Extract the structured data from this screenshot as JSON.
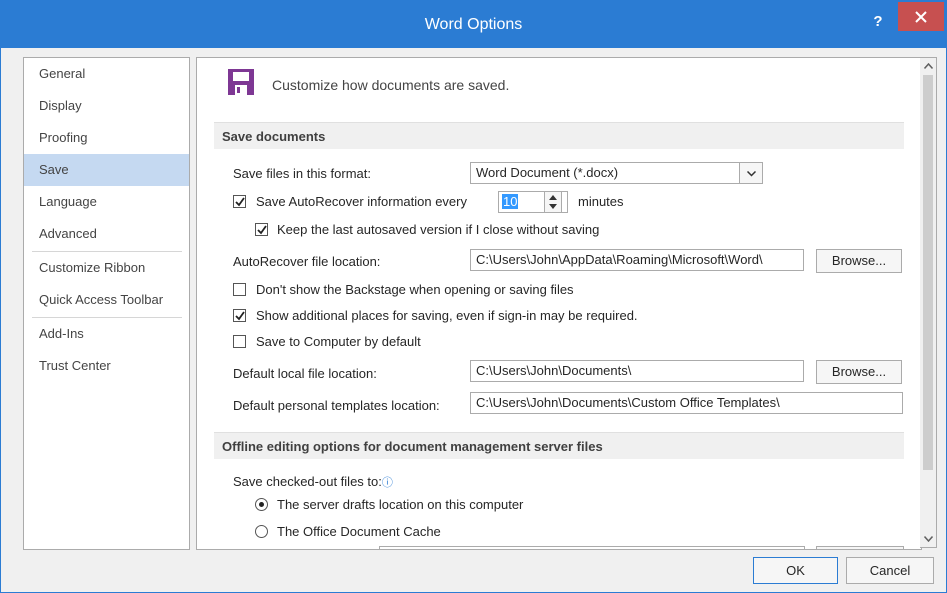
{
  "window": {
    "title": "Word Options",
    "help_glyph": "?",
    "accent": "#2b7cd3",
    "close_color": "#c75050"
  },
  "sidebar": {
    "items": [
      {
        "label": "General"
      },
      {
        "label": "Display"
      },
      {
        "label": "Proofing"
      },
      {
        "label": "Save",
        "selected": true
      },
      {
        "label": "Language"
      },
      {
        "label": "Advanced"
      },
      {
        "label": "Customize Ribbon"
      },
      {
        "label": "Quick Access Toolbar"
      },
      {
        "label": "Add-Ins"
      },
      {
        "label": "Trust Center"
      }
    ]
  },
  "header": {
    "text": "Customize how documents are saved.",
    "icon": "floppy-disk-icon",
    "icon_color": "#7e3794"
  },
  "save_section": {
    "title": "Save documents",
    "format_label": "Save files in this format:",
    "format_value": "Word Document (*.docx)",
    "autorecover_label": "Save AutoRecover information every",
    "autorecover_minutes": "10",
    "minutes_label": "minutes",
    "keep_last_label": "Keep the last autosaved version if I close without saving",
    "autorecover_location_label": "AutoRecover file location:",
    "autorecover_location_value": "C:\\Users\\John\\AppData\\Roaming\\Microsoft\\Word\\",
    "browse_label": "Browse...",
    "dont_show_backstage_label": "Don't show the Backstage when opening or saving files",
    "show_places_label": "Show additional places for saving, even if sign-in may be required.",
    "save_to_computer_label": "Save to Computer by default",
    "default_local_label": "Default local file location:",
    "default_local_value": "C:\\Users\\John\\Documents\\",
    "default_templates_label": "Default personal templates location:",
    "default_templates_value": "C:\\Users\\John\\Documents\\Custom Office Templates\\"
  },
  "checkboxes": {
    "autorecover": true,
    "keep_last": true,
    "dont_show_backstage": false,
    "show_places": true,
    "save_to_computer": false
  },
  "offline_section": {
    "title": "Offline editing options for document management server files",
    "checked_out_label": "Save checked-out files to:",
    "info_glyph": "ⓘ",
    "server_drafts_label": "The server drafts location on this computer",
    "office_cache_label": "The Office Document Cache",
    "selected_option": "server_drafts"
  },
  "footer": {
    "ok_label": "OK",
    "cancel_label": "Cancel"
  }
}
